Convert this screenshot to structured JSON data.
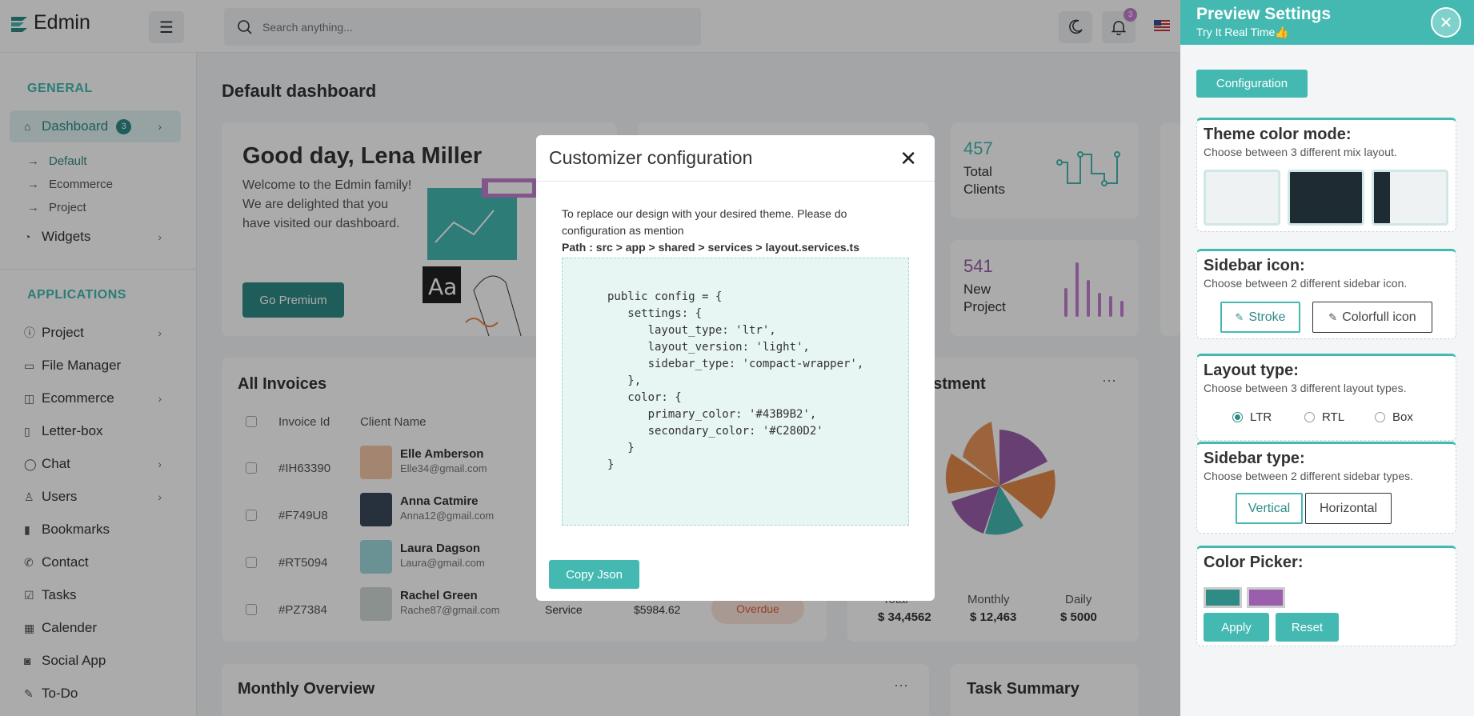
{
  "app": {
    "name": "Edmin"
  },
  "topbar": {
    "search_placeholder": "Search anything...",
    "notif_count": "3"
  },
  "sidebar": {
    "general": "GENERAL",
    "applications": "APPLICATIONS",
    "dashboard": {
      "label": "Dashboard",
      "badge": "3"
    },
    "sub": [
      "Default",
      "Ecommerce",
      "Project"
    ],
    "widgets": "Widgets",
    "apps": [
      "Project",
      "File Manager",
      "Ecommerce",
      "Letter-box",
      "Chat",
      "Users",
      "Bookmarks",
      "Contact",
      "Tasks",
      "Calender",
      "Social App",
      "To-Do"
    ]
  },
  "main": {
    "title": "Default dashboard",
    "greeting": {
      "title": "Good day, Lena Miller",
      "text1": "Welcome to the Edmin family!",
      "text2": "We are delighted that you",
      "text3": "have visited our dashboard.",
      "button": "Go Premium",
      "aa": "Aa"
    },
    "stats": [
      {
        "value": "457",
        "label1": "Total",
        "label2": "Clients"
      },
      {
        "value": "541",
        "label1": "New",
        "label2": "Project"
      }
    ],
    "invoices": {
      "title": "All Invoices",
      "headers": [
        "Invoice Id",
        "Client Name"
      ],
      "rows": [
        {
          "id": "#IH63390",
          "name": "Elle Amberson",
          "email": "Elle34@gmail.com"
        },
        {
          "id": "#F749U8",
          "name": "Anna Catmire",
          "email": "Anna12@gmail.com"
        },
        {
          "id": "#RT5094",
          "name": "Laura Dagson",
          "email": "Laura@gmail.com"
        },
        {
          "id": "#PZ7384",
          "name": "Rachel Green",
          "email": "Rache87@gmail.com",
          "service": "Service",
          "amount": "$5984.62",
          "status": "Overdue"
        }
      ]
    },
    "investment": {
      "title": "estment",
      "totals": [
        {
          "label": "Total",
          "value": "$ 34,4562"
        },
        {
          "label": "Monthly",
          "value": "$ 12,463"
        },
        {
          "label": "Daily",
          "value": "$ 5000"
        }
      ]
    },
    "monthly": "Monthly Overview",
    "task": "Task Summary"
  },
  "modal": {
    "title": "Customizer configuration",
    "line1": "To replace our design with your desired theme. Please do",
    "line2": "configuration as mention",
    "path": "Path : src > app > shared > services > layout.services.ts",
    "code": "public config = {\n   settings: {\n      layout_type: 'ltr',\n      layout_version: 'light',\n      sidebar_type: 'compact-wrapper',\n   },\n   color: {\n      primary_color: '#43B9B2',\n      secondary_color: '#C280D2'\n   }\n}",
    "copy": "Copy Json"
  },
  "panel": {
    "title": "Preview Settings",
    "sub": "Try It Real Time👍",
    "config": "Configuration",
    "theme": {
      "title": "Theme color mode:",
      "desc": "Choose between 3 different mix layout."
    },
    "sidebar_icon": {
      "title": "Sidebar icon:",
      "desc": "Choose between 2 different sidebar icon.",
      "opt1": "Stroke",
      "opt2": "Colorfull icon"
    },
    "layout": {
      "title": "Layout type:",
      "desc": "Choose between 3 different layout types.",
      "opts": [
        "LTR",
        "RTL",
        "Box"
      ]
    },
    "sidebar_type": {
      "title": "Sidebar type:",
      "desc": "Choose between 2 different sidebar types.",
      "opt1": "Vertical",
      "opt2": "Horizontal"
    },
    "color": {
      "title": "Color Picker:",
      "apply": "Apply",
      "reset": "Reset",
      "primary": "#2e8b85",
      "secondary": "#9a5eac"
    }
  }
}
